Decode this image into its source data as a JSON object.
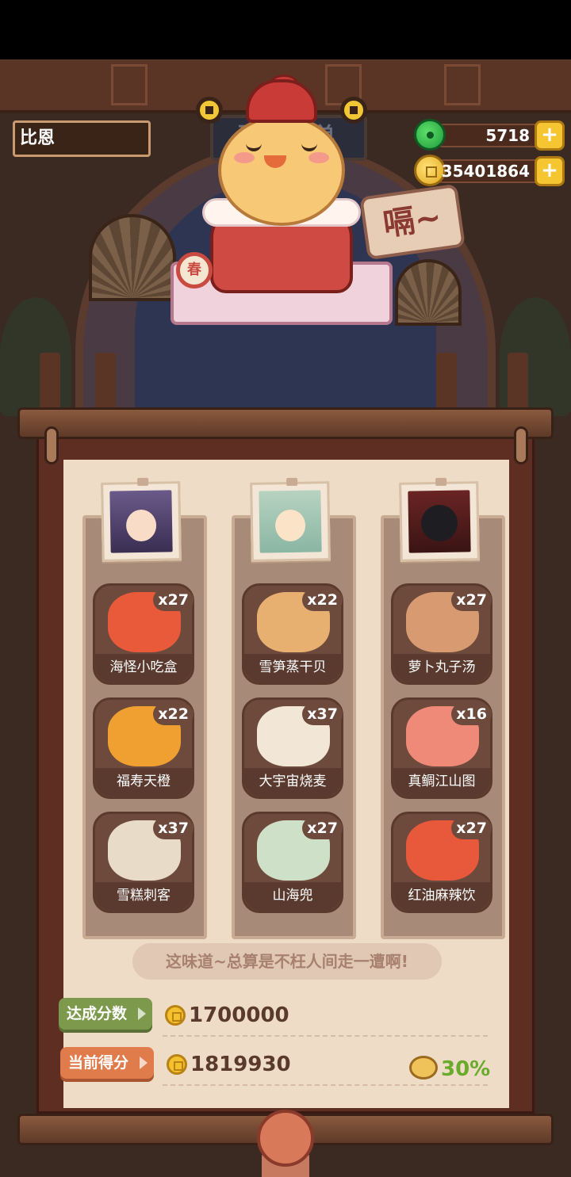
{
  "player": {
    "name": "比恩"
  },
  "currency": {
    "jade": {
      "icon": "jade-icon",
      "value": "5718"
    },
    "gold": {
      "icon": "gold-coin-icon",
      "value": "35401864"
    }
  },
  "scene": {
    "sign_text": "确认菜单",
    "speech_bubble": "嗝~",
    "drum_text": "春"
  },
  "columns": [
    {
      "portrait": "empress-portrait",
      "dishes": [
        {
          "name": "海怪小吃盒",
          "count": "x27",
          "color": "#e85a3a"
        },
        {
          "name": "福寿天橙",
          "count": "x22",
          "color": "#f0a030"
        },
        {
          "name": "雪糕刺客",
          "count": "x37",
          "color": "#e8dcc8"
        }
      ]
    },
    {
      "portrait": "scholar-portrait",
      "dishes": [
        {
          "name": "雪笋蒸干贝",
          "count": "x22",
          "color": "#e8b070"
        },
        {
          "name": "大宇宙烧麦",
          "count": "x37",
          "color": "#f2e6d6"
        },
        {
          "name": "山海兜",
          "count": "x27",
          "color": "#cfe0c8"
        }
      ]
    },
    {
      "portrait": "black-dog-portrait",
      "dishes": [
        {
          "name": "萝卜丸子汤",
          "count": "x27",
          "color": "#d89a70"
        },
        {
          "name": "真鲷江山图",
          "count": "x16",
          "color": "#f08a78"
        },
        {
          "name": "红油麻辣饮",
          "count": "x27",
          "color": "#e8583a"
        }
      ]
    }
  ],
  "quote": "这味道~总算是不枉人间走一遭啊!",
  "score": {
    "target_label": "达成分数",
    "target_value": "1700000",
    "current_label": "当前得分",
    "current_value": "1819930",
    "bonus_percent": "30%"
  },
  "colors": {
    "accent_green": "#6aaa2c",
    "accent_orange": "#e07c4c",
    "paper": "#eedcc6"
  }
}
